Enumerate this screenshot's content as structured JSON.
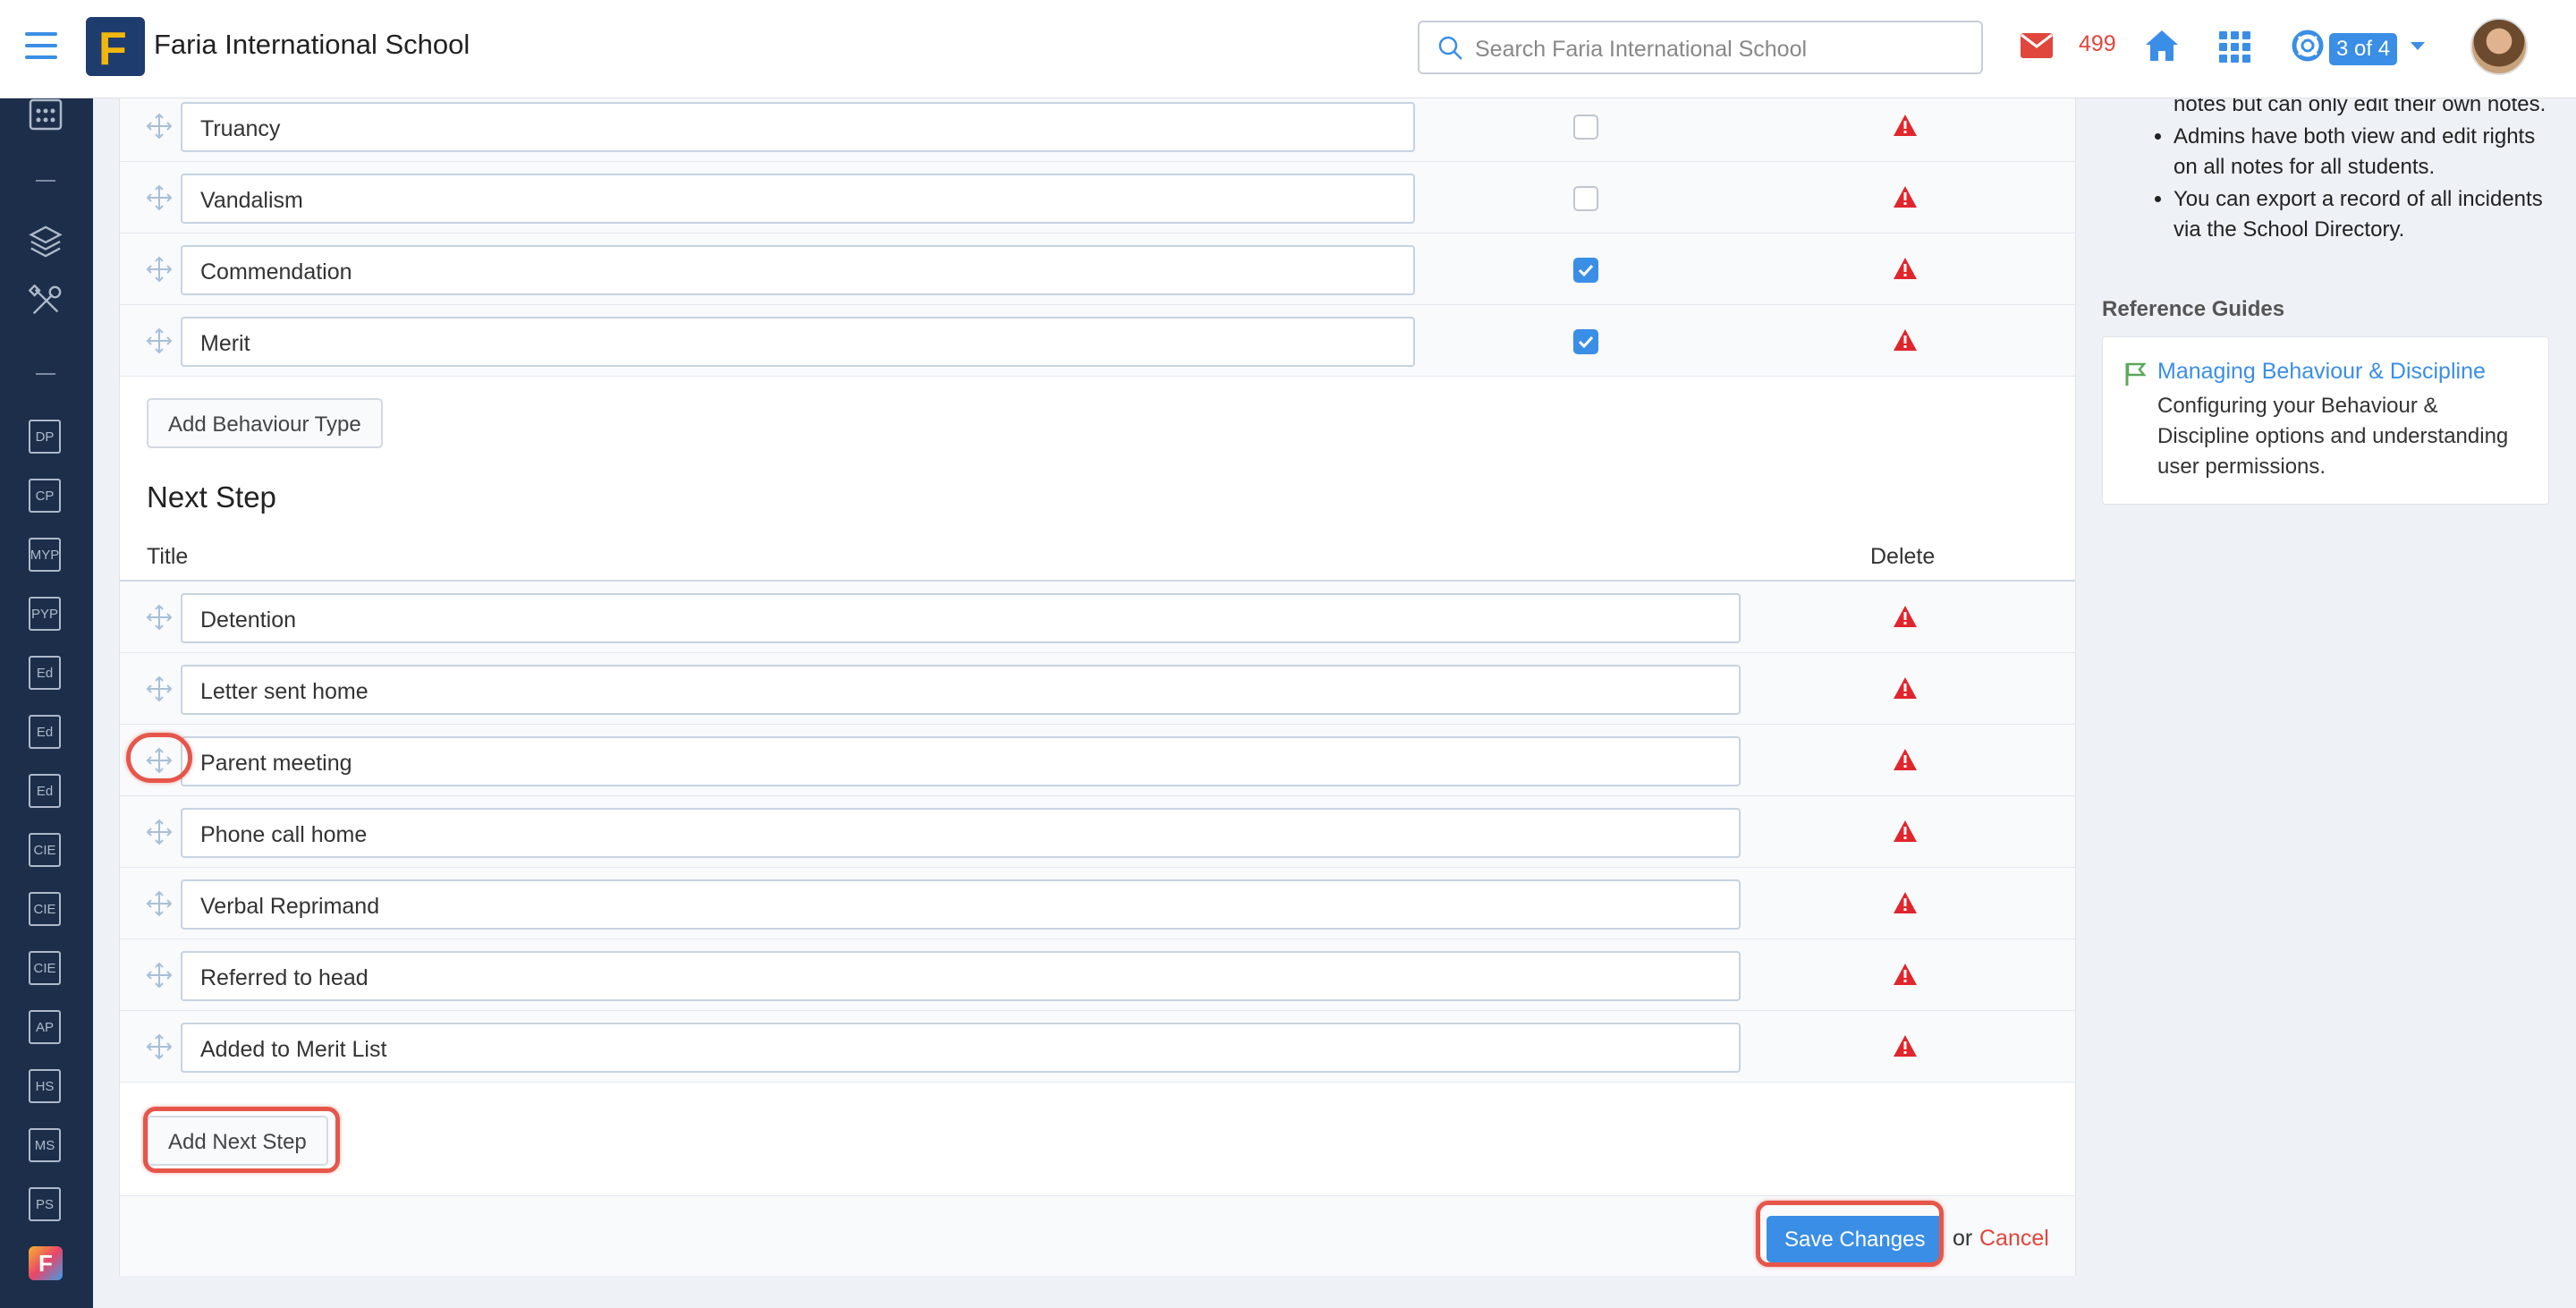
{
  "header": {
    "school_name": "Faria International School",
    "logo_letter": "F",
    "search_placeholder": "Search Faria International School",
    "mail_count": "499",
    "pager": "3 of 4"
  },
  "sidebar": {
    "items": [
      "DP",
      "CP",
      "MYP",
      "PYP",
      "Ed",
      "Ed",
      "Ed",
      "CIE",
      "CIE",
      "CIE",
      "AP",
      "HS",
      "MS",
      "PS"
    ]
  },
  "behaviour_types": {
    "rows": [
      {
        "title": "Truancy",
        "checked": false
      },
      {
        "title": "Vandalism",
        "checked": false
      },
      {
        "title": "Commendation",
        "checked": true
      },
      {
        "title": "Merit",
        "checked": true
      }
    ],
    "add_label": "Add Behaviour Type"
  },
  "next_step": {
    "section_title": "Next Step",
    "col_title": "Title",
    "col_delete": "Delete",
    "rows": [
      "Detention",
      "Letter sent home",
      "Parent meeting",
      "Phone call home",
      "Verbal Reprimand",
      "Referred to head",
      "Added to Merit List"
    ],
    "add_label": "Add Next Step"
  },
  "footer": {
    "save_label": "Save Changes",
    "or_text": "or",
    "cancel_label": "Cancel"
  },
  "aside": {
    "notes": [
      "notes but can only edit their own notes.",
      "Admins have both view and edit rights on all notes for all students.",
      "You can export a record of all incidents via the School Directory."
    ],
    "reference_heading": "Reference Guides",
    "guide_title": "Managing Behaviour & Discipline",
    "guide_desc": "Configuring your Behaviour & Discipline options and understanding user permissions."
  },
  "colors": {
    "accent": "#3a8ee6",
    "danger": "#e0463c",
    "sidebar": "#1c2e4a",
    "highlight": "#e6564a"
  }
}
